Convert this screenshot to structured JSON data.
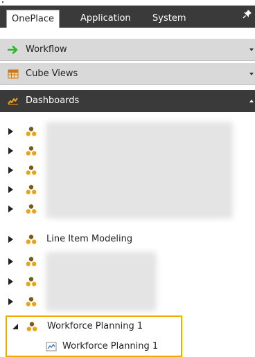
{
  "tabs": [
    {
      "label": "OnePlace",
      "active": true
    },
    {
      "label": "Application",
      "active": false
    },
    {
      "label": "System",
      "active": false
    }
  ],
  "pin_icon": "pin-icon",
  "accordion": [
    {
      "label": "Workflow",
      "icon": "arrow-right-icon",
      "icon_color": "#2db82d",
      "expanded": false
    },
    {
      "label": "Cube Views",
      "icon": "grid-table-icon",
      "icon_color": "#c8781e",
      "expanded": false
    },
    {
      "label": "Dashboards",
      "icon": "dashboard-chart-icon",
      "icon_color": "#f2a900",
      "expanded": true
    }
  ],
  "tree": {
    "visible_item": "Line Item Modeling",
    "selected_group": "Workforce Planning 1",
    "selected_child": "Workforce Planning 1",
    "group_icon_color": "#e8a317",
    "group_icon_dark": "#7a5a18"
  },
  "colors": {
    "header_dark": "#3a3a3a",
    "accordion_bg": "#d9d9d9",
    "highlight": "#f2a900"
  }
}
